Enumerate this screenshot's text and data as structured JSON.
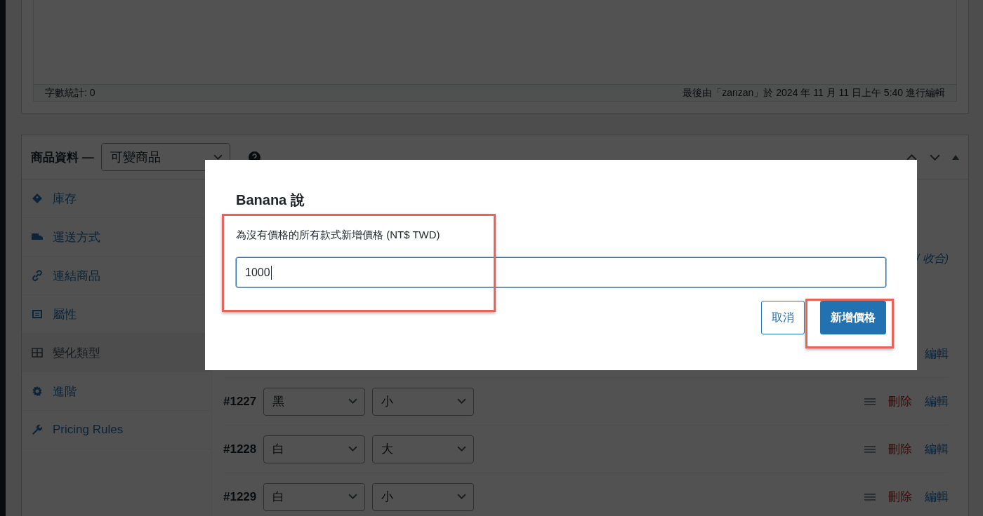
{
  "editor": {
    "word_count": "字數統計: 0",
    "last_edited": "最後由「zanzan」於 2024 年 11 月 11 日上午 5:40 進行編輯"
  },
  "product_data": {
    "title": "商品資料 —",
    "type_select": "可變商品",
    "tabs": [
      {
        "label": "庫存",
        "selected": false
      },
      {
        "label": "運送方式",
        "selected": false
      },
      {
        "label": "連結商品",
        "selected": false
      },
      {
        "label": "屬性",
        "selected": false
      },
      {
        "label": "變化類型",
        "selected": true
      },
      {
        "label": "進階",
        "selected": false
      },
      {
        "label": "Pricing Rules",
        "selected": false
      }
    ],
    "expand_link": "/ 收合)",
    "partial_row_edit": "編輯",
    "variations": [
      {
        "id": "#1227",
        "attribute_1": "黑",
        "attribute_2": "小",
        "delete": "刪除",
        "edit": "編輯"
      },
      {
        "id": "#1228",
        "attribute_1": "白",
        "attribute_2": "大",
        "delete": "刪除",
        "edit": "編輯"
      },
      {
        "id": "#1229",
        "attribute_1": "白",
        "attribute_2": "小",
        "delete": "刪除",
        "edit": "編輯"
      }
    ]
  },
  "dialog": {
    "title": "Banana 說",
    "label": "為沒有價格的所有款式新增價格 (NT$ TWD)",
    "value": "1000",
    "field_highlighted": true,
    "buttons": [
      {
        "label": "取消",
        "kind": "secondary",
        "highlighted": false
      },
      {
        "label": "新增價格",
        "kind": "primary",
        "highlighted": true
      }
    ]
  }
}
